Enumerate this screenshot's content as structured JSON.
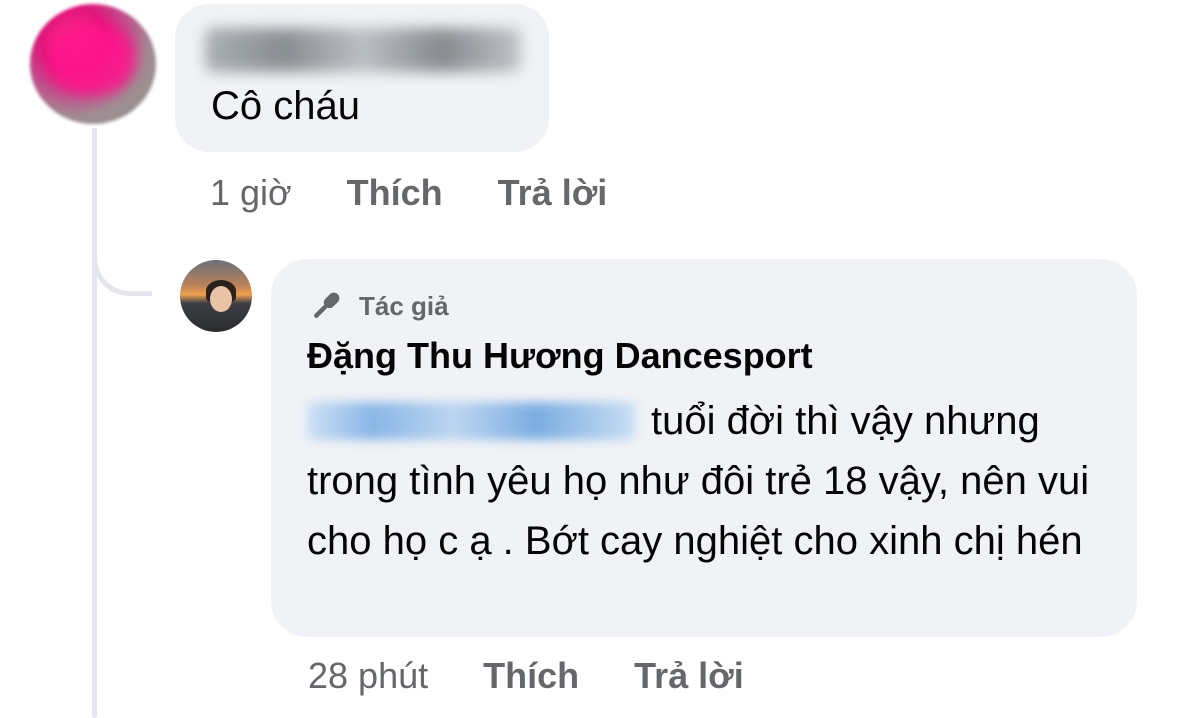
{
  "comment1": {
    "author_name": "",
    "text": "Cô cháu",
    "time": "1 giờ",
    "like_label": "Thích",
    "reply_label": "Trả lời"
  },
  "comment2": {
    "badge_icon": "microphone-icon",
    "badge_label": "Tác giả",
    "author_name": "Đặng Thu Hương Dancesport",
    "mention": "",
    "text": "tuổi đời thì vậy nhưng trong tình yêu họ như đôi trẻ 18 vậy, nên vui cho họ c ạ . Bớt cay nghiệt cho xinh chị hén",
    "time": "28 phút",
    "like_label": "Thích",
    "reply_label": "Trả lời"
  },
  "colors": {
    "bubble": "#f0f2f5",
    "meta_text": "#65676b",
    "thread_line": "#e4e6eb"
  }
}
